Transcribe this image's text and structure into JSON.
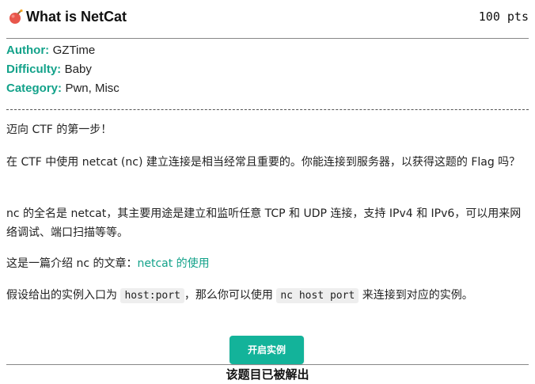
{
  "challenge": {
    "title": "What is NetCat",
    "points": "100 pts",
    "icon": "bomb-icon"
  },
  "meta": {
    "author_key": "Author:",
    "author_value": "GZTime",
    "difficulty_key": "Difficulty:",
    "difficulty_value": "Baby",
    "category_key": "Category:",
    "category_value": "Pwn, Misc"
  },
  "description": {
    "p1": "迈向 CTF 的第一步！",
    "p2": "在 CTF 中使用 netcat (nc) 建立连接是相当经常且重要的。你能连接到服务器，以获得这题的 Flag 吗？",
    "p3": "nc 的全名是 netcat，其主要用途是建立和监听任意 TCP 和 UDP 连接，支持 IPv4 和 IPv6，可以用来网络调试、端口扫描等等。",
    "p4_prefix": "这是一篇介绍 nc 的文章：",
    "p4_link": "netcat 的使用",
    "p5_part1": "假设给出的实例入口为 ",
    "p5_code1": "host:port",
    "p5_part2": "，那么你可以使用 ",
    "p5_code2": "nc host port",
    "p5_part3": " 来连接到对应的实例。"
  },
  "actions": {
    "start_instance": "开启实例"
  },
  "status": {
    "solved_text": "该题目已被解出"
  },
  "colors": {
    "accent": "#13a28a",
    "button": "#13b39a"
  }
}
